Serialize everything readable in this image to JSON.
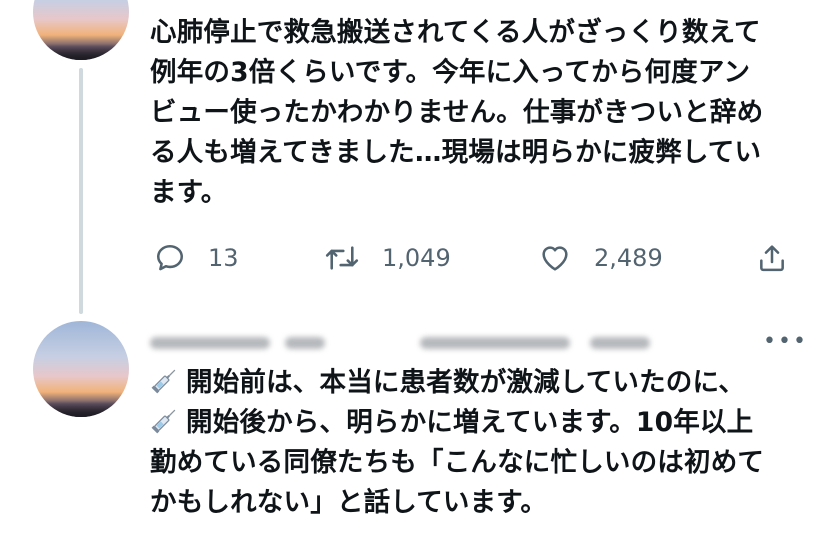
{
  "tweet_top": {
    "lines": [
      "心肺停止で救急搬送されてくる人がざっくり数えて",
      "例年の3倍くらいです。今年に入ってから何度アン",
      "ビュー使ったかわかりません。仕事がきついと辞め",
      "る人も増えてきました…現場は明らかに疲弊してい",
      "ます。"
    ],
    "actions": {
      "reply_count": "13",
      "retweet_count": "1,049",
      "like_count": "2,489"
    }
  },
  "tweet_bottom": {
    "lines": [
      "開始前は、本当に患者数が激減していたのに、",
      "開始後から、明らかに増えています。10年以上",
      "勤めている同僚たちも「こんなに忙しいのは初めて",
      "かもしれない」と話しています。"
    ],
    "more_label": "•••",
    "emoji": "syringe-icon"
  },
  "colors": {
    "text": "#0f1419",
    "muted": "#536471",
    "line": "#cfd9de"
  }
}
